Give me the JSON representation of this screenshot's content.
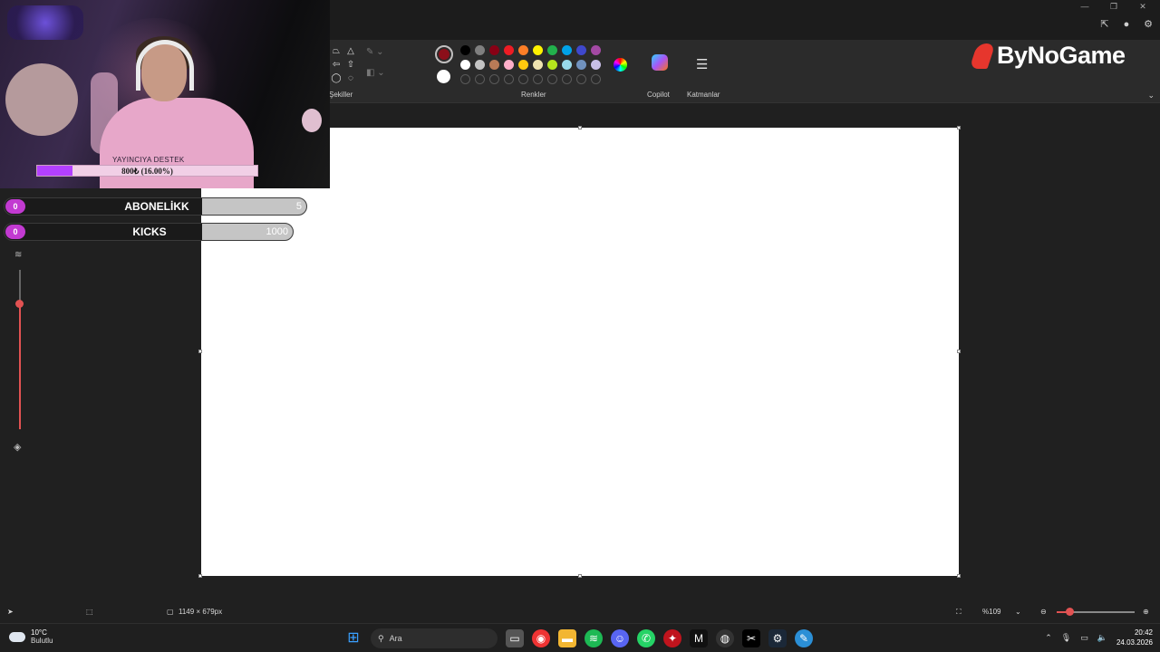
{
  "window": {
    "controls": [
      "—",
      "❐",
      "✕"
    ]
  },
  "ribbon": {
    "groups": {
      "shapes_label": "Şekiller",
      "colors_label": "Renkler",
      "copilot_label": "Copilot",
      "layers_label": "Katmanlar"
    },
    "primary_color": "#8b0f1a",
    "secondary_color": "#ffffff",
    "palette": [
      "#000000",
      "#7f7f7f",
      "#880015",
      "#ed1c24",
      "#ff7f27",
      "#fff200",
      "#22b14c",
      "#00a2e8",
      "#3f48cc",
      "#a349a4",
      "#ffffff",
      "#c3c3c3",
      "#b97a57",
      "#ffaec9",
      "#ffc90e",
      "#efe4b0",
      "#b5e61d",
      "#99d9ea",
      "#7092be",
      "#c8bfe7",
      "",
      "",
      "",
      "",
      "",
      "",
      "",
      "",
      "",
      ""
    ]
  },
  "brand": {
    "logo_text": "ByNoGame"
  },
  "overlay": {
    "support_title": "YAYINCIYA DESTEK",
    "support_text": "800₺ (16.00%)",
    "support_progress": 16,
    "goals": [
      {
        "badge": "0",
        "label": "ABONELİKK",
        "value": "5"
      },
      {
        "badge": "0",
        "label": "KICKS",
        "value": "1000"
      }
    ]
  },
  "statusbar": {
    "canvas_size": "1149 × 679px",
    "zoom": "%109",
    "zoom_level": 0.12
  },
  "taskbar": {
    "temperature": "10°C",
    "weather": "Bulutlu",
    "search_placeholder": "Ara",
    "time": "20:42",
    "date": "24.03.2026"
  }
}
